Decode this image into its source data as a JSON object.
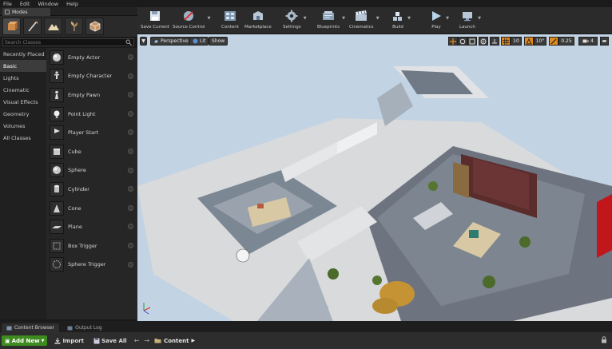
{
  "menu": [
    "File",
    "Edit",
    "Window",
    "Help"
  ],
  "modes_tab": {
    "label": "Modes"
  },
  "search": {
    "placeholder": "Search Classes"
  },
  "categories": [
    "Recently Placed",
    "Basic",
    "Lights",
    "Cinematic",
    "Visual Effects",
    "Geometry",
    "Volumes",
    "All Classes"
  ],
  "selected_category": "Basic",
  "items": [
    "Empty Actor",
    "Empty Character",
    "Empty Pawn",
    "Point Light",
    "Player Start",
    "Cube",
    "Sphere",
    "Cylinder",
    "Cone",
    "Plane",
    "Box Trigger",
    "Sphere Trigger"
  ],
  "toolbar": {
    "save": "Save Current",
    "source": "Source Control",
    "content": "Content",
    "marketplace": "Marketplace",
    "settings": "Settings",
    "blueprints": "Blueprints",
    "cinematics": "Cinematics",
    "build": "Build",
    "play": "Play",
    "launch": "Launch"
  },
  "viewport": {
    "perspective": "Perspective",
    "lit": "Lit",
    "show": "Show",
    "grid_snap": "10",
    "rot_snap": "10°",
    "scale_snap": "0.25",
    "cam_speed": "4"
  },
  "bottom_tabs": [
    "Content Browser",
    "Output Log"
  ],
  "content_bar": {
    "add_new": "Add New",
    "import": "Import",
    "save_all": "Save All",
    "path": "Content"
  },
  "colors": {
    "accent_green": "#3d8a1f",
    "panel": "#262626",
    "viewport_sky": "#c2d3e3",
    "snap_orange": "#e08a1e"
  }
}
